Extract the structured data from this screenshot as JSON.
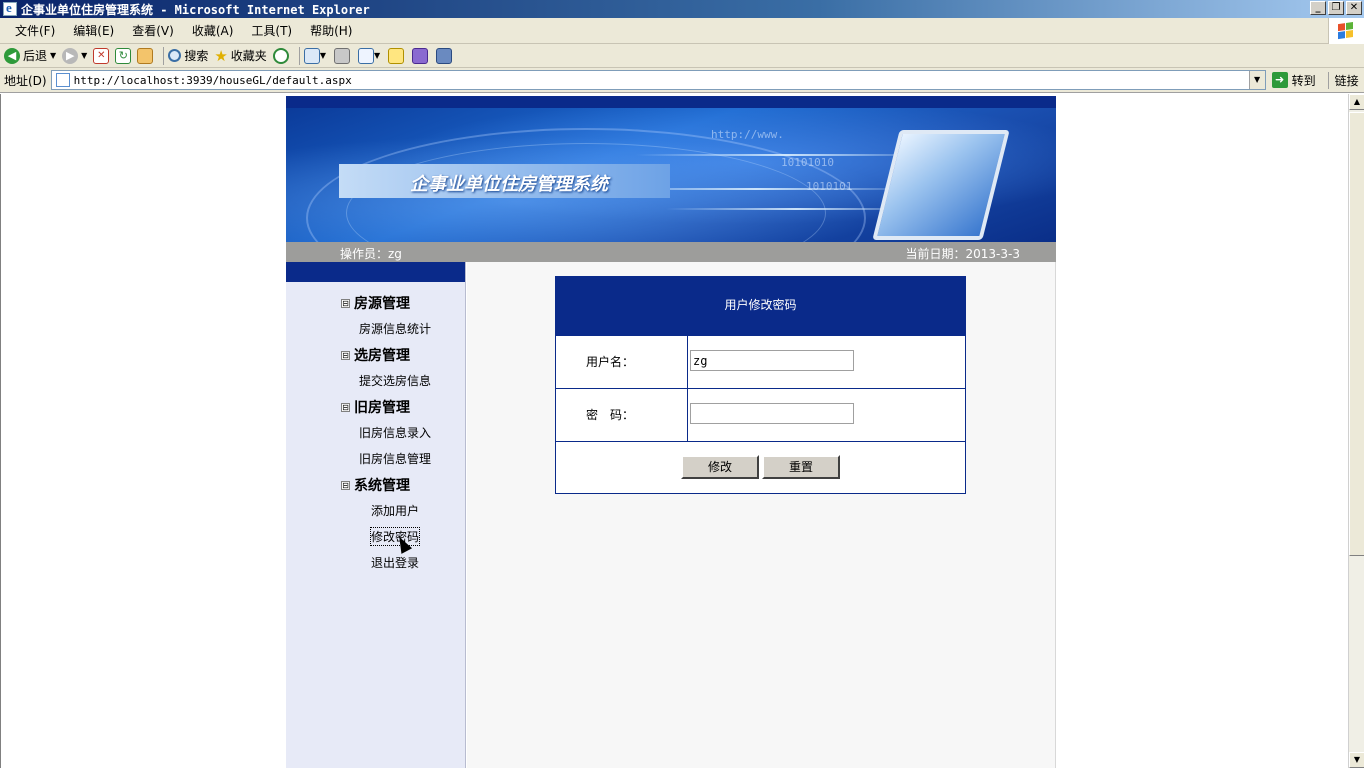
{
  "window": {
    "title": "企事业单位住房管理系统 - Microsoft Internet Explorer",
    "buttons": [
      "_",
      "❐",
      "✕"
    ]
  },
  "menu": [
    "文件(F)",
    "编辑(E)",
    "查看(V)",
    "收藏(A)",
    "工具(T)",
    "帮助(H)"
  ],
  "toolbar": {
    "back": "后退",
    "search": "搜索",
    "favorites": "收藏夹"
  },
  "address": {
    "label": "地址(D)",
    "url": "http://localhost:3939/houseGL/default.aspx",
    "go": "转到",
    "links": "链接"
  },
  "banner": {
    "title": "企事业单位住房管理系统",
    "decor_text_1": "http://www.",
    "decor_text_2": "10101010",
    "decor_text_3": "1010101"
  },
  "infobar": {
    "operator": "操作员：zg",
    "date": "当前日期：2013-3-3"
  },
  "sidebar": {
    "groups": [
      {
        "toggle": "⊟",
        "label": "房源管理",
        "items": [
          "房源信息统计"
        ]
      },
      {
        "toggle": "⊟",
        "label": "选房管理",
        "items": [
          "提交选房信息"
        ]
      },
      {
        "toggle": "⊟",
        "label": "旧房管理",
        "items": [
          "旧房信息录入",
          "旧房信息管理"
        ]
      },
      {
        "toggle": "⊟",
        "label": "系统管理",
        "items": [
          "添加用户",
          "修改密码",
          "退出登录"
        ]
      }
    ]
  },
  "form": {
    "title": "用户修改密码",
    "username_label": "用户名：",
    "username_value": "zg",
    "password_label": "密　码：",
    "password_value": "",
    "submit": "修改",
    "reset": "重置"
  }
}
